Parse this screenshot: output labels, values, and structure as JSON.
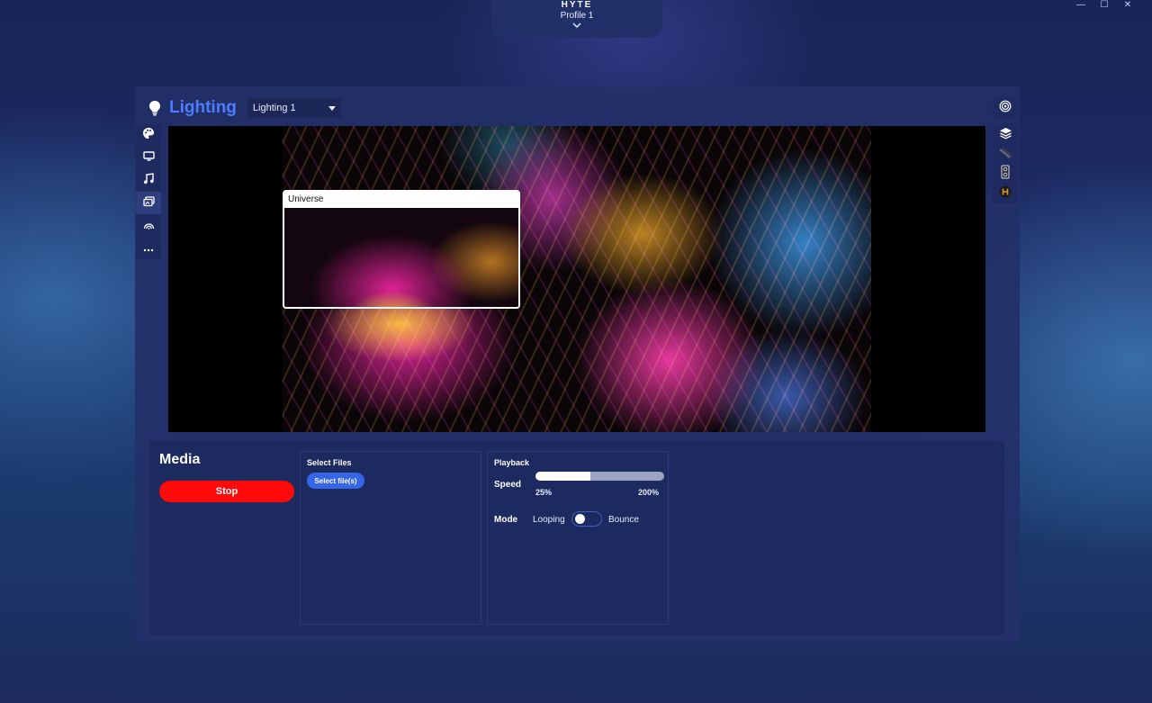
{
  "window": {
    "minimize": "—",
    "maximize": "☐",
    "close": "✕"
  },
  "profile": {
    "logo": "HYTE",
    "name": "Profile 1"
  },
  "header": {
    "title": "Lighting",
    "dropdown_value": "Lighting 1"
  },
  "left_nav": {
    "items": [
      {
        "icon": "palette-icon"
      },
      {
        "icon": "monitor-icon"
      },
      {
        "icon": "music-icon"
      },
      {
        "icon": "media-icon",
        "active": true
      },
      {
        "icon": "ambient-icon"
      },
      {
        "icon": "more-icon"
      }
    ]
  },
  "right_nav": {
    "top": "target-icon",
    "items": [
      "layers-icon",
      "strip-icon",
      "fan-device-icon",
      "hyte-h-icon"
    ]
  },
  "preview": {
    "window_title": "Universe"
  },
  "media": {
    "title": "Media",
    "stop_label": "Stop",
    "select_files": {
      "title": "Select Files",
      "button": "Select file(s)"
    },
    "playback": {
      "title": "Playback",
      "speed_label": "Speed",
      "speed_min": "25%",
      "speed_max": "200%",
      "speed_fraction": 0.43,
      "mode_label": "Mode",
      "mode_left": "Looping",
      "mode_right": "Bounce",
      "mode_bounce_on": false
    }
  },
  "colors": {
    "accent": "#4d7cff",
    "stop": "#ff0a0a",
    "button": "#3566e8"
  }
}
